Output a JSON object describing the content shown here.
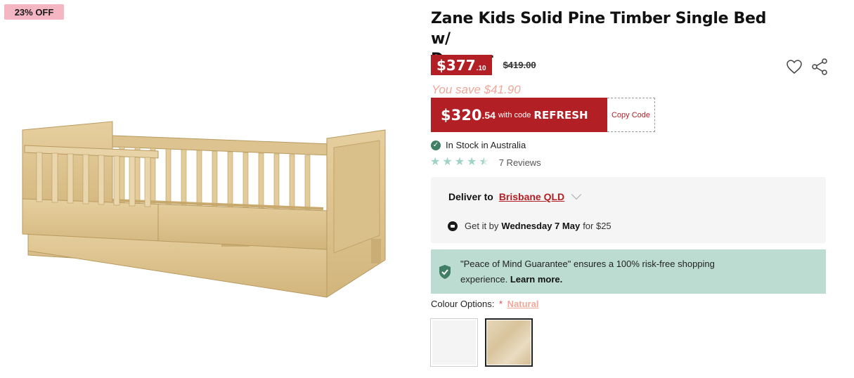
{
  "badge": {
    "discount": "23% OFF"
  },
  "product": {
    "title_line1": "Zane Kids Solid Pine Timber Single Bed w/",
    "title_line2": "Drawer"
  },
  "price": {
    "main": "$377",
    "cents": ".10",
    "original": "$419.00",
    "you_save": "You save $41.90"
  },
  "promo": {
    "main": "$320",
    "cents": ".54",
    "with_text": "with code",
    "code": "REFRESH",
    "copy_label": "Copy Code"
  },
  "stock": {
    "text": "In Stock in Australia"
  },
  "reviews": {
    "rating": 4.5,
    "count_text": "7 Reviews"
  },
  "delivery": {
    "label": "Deliver to",
    "location": "Brisbane QLD",
    "get_it": "Get it by",
    "date": "Wednesday 7 May",
    "cost": "for $25"
  },
  "guarantee": {
    "text": "\"Peace of Mind Guarantee\" ensures a 100% risk-free shopping experience.",
    "link": "Learn more."
  },
  "colour": {
    "label": "Colour Options:",
    "required": "*",
    "selected": "Natural",
    "options": [
      {
        "name": "White",
        "color": "#f4f4f4"
      },
      {
        "name": "Natural",
        "color": "#e2d3b5"
      }
    ]
  },
  "colors": {
    "accent": "#b21f24",
    "badge": "#f5b6c4",
    "save_text": "#f1a89b",
    "guarantee_bg": "#bcdcd1",
    "star": "#9fd3c6",
    "stock_icon": "#3f7f66"
  },
  "icons": {
    "wishlist": "heart-icon",
    "share": "share-icon",
    "stock": "check-circle-icon",
    "delivery": "truck-icon",
    "guarantee": "shield-check-icon"
  }
}
